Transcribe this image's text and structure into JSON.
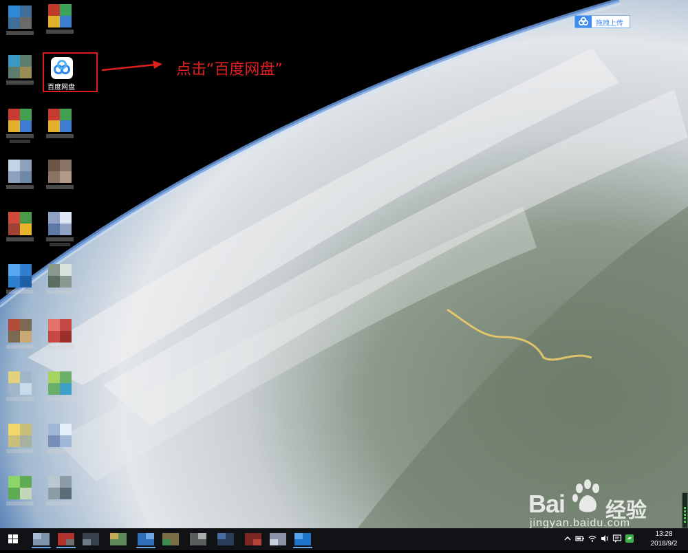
{
  "desktop": {
    "baidu_pan_icon_label": "百度网盘",
    "annotation": "点击“百度网盘”",
    "pixelated_icon_labels": [
      "i",
      "5",
      "文",
      "cc",
      "f",
      "B",
      "t"
    ]
  },
  "upload_widget": {
    "label": "拖拽上传"
  },
  "watermark": {
    "brand": "Bai",
    "brand_suffix": "经验",
    "url": "jingyan.baidu.com"
  },
  "taskbar": {
    "start_icon": "windows-logo-icon",
    "clock": {
      "time": "13:28",
      "date": "2018/9/2"
    },
    "tray_icons": [
      "chevron-up-icon",
      "battery-icon",
      "wifi-icon",
      "volume-icon",
      "action-center-icon",
      "app-tray-icon"
    ]
  },
  "colors": {
    "annotation_red": "#e01f1f",
    "baidu_blue": "#3d8df1",
    "taskbar_bg": "#101216"
  }
}
